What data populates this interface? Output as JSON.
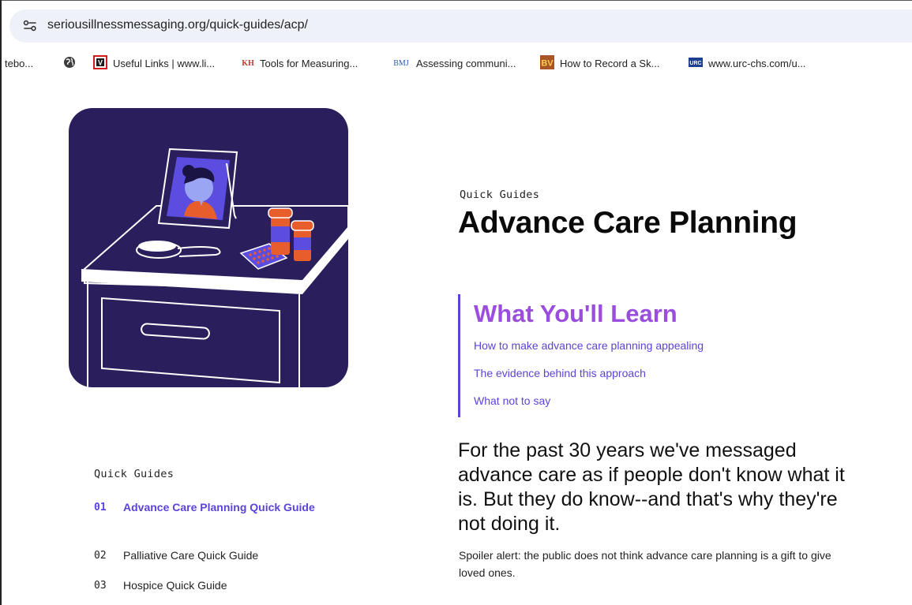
{
  "browser": {
    "url": "seriousillnessmessaging.org/quick-guides/acp/"
  },
  "bookmarks": [
    {
      "label": "tebo...",
      "icon": "none"
    },
    {
      "label": "",
      "icon": "globe-icon"
    },
    {
      "label": "Useful Links | www.li...",
      "icon": "v-logo-icon"
    },
    {
      "label": "Tools for Measuring...",
      "icon": "kh-logo-icon"
    },
    {
      "label": "Assessing communi...",
      "icon": "bmj-logo-icon"
    },
    {
      "label": "How to Record a Sk...",
      "icon": "bv-logo-icon"
    },
    {
      "label": "www.urc-chs.com/u...",
      "icon": "urc-logo-icon"
    }
  ],
  "bookmark_logo_text": {
    "v": "V",
    "kh": "KH",
    "bmj": "BMJ",
    "bv": "BV",
    "urc": "URC"
  },
  "sidebar": {
    "heading": "Quick Guides",
    "items": [
      {
        "num": "01",
        "label": "Advance Care Planning Quick Guide",
        "active": true
      },
      {
        "num": "02",
        "label": "Palliative Care Quick Guide",
        "active": false
      },
      {
        "num": "03",
        "label": "Hospice Quick Guide",
        "active": false
      }
    ]
  },
  "main": {
    "eyebrow": "Quick Guides",
    "title": "Advance Care Planning",
    "learn": {
      "heading": "What You'll Learn",
      "links": [
        "How to make advance care planning appealing",
        "The evidence behind this approach",
        "What not to say"
      ]
    },
    "intro_lines": [
      "For the past 30 years we've messaged",
      "advance care as if people don't know what it",
      "is. But they do know--and that's why they're",
      "not doing it."
    ],
    "spoiler_lines": [
      "Spoiler alert: the public does not think advance care planning is a gift to give",
      "loved ones."
    ]
  },
  "colors": {
    "accent_purple": "#5b44d6",
    "heading_violet": "#9b4dde",
    "illustration_bg": "#2a1f5c",
    "pill_orange": "#e85d2c"
  }
}
